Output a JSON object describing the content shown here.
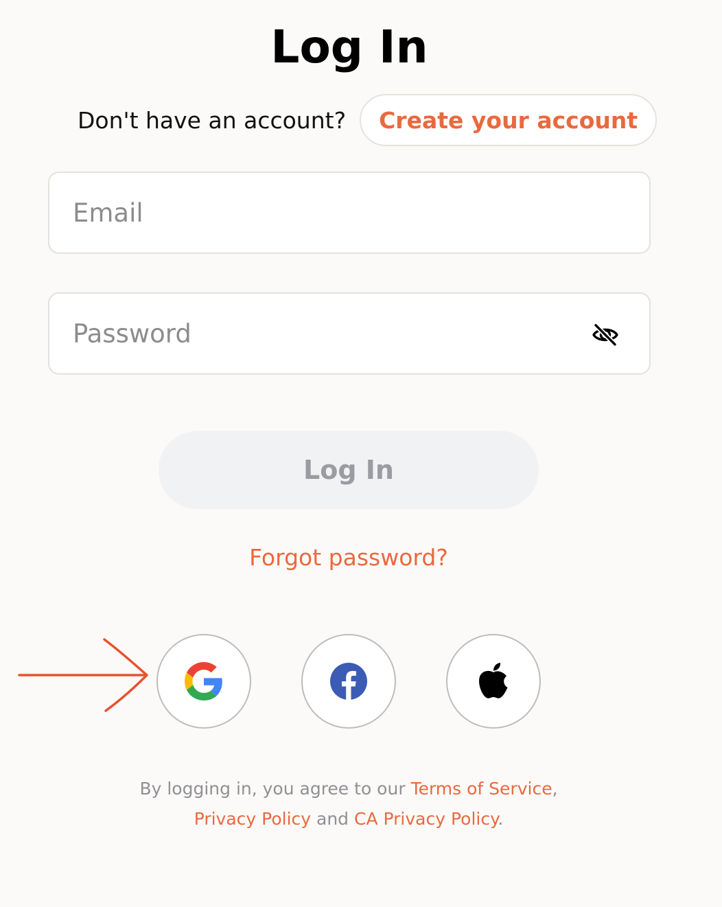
{
  "page": {
    "title": "Log In"
  },
  "signup": {
    "prompt": "Don't have an account?",
    "create_label": "Create your account"
  },
  "form": {
    "email_placeholder": "Email",
    "password_placeholder": "Password",
    "submit_label": "Log In",
    "forgot_label": "Forgot password?"
  },
  "social": {
    "providers": [
      {
        "name": "Google",
        "icon": "google-icon"
      },
      {
        "name": "Facebook",
        "icon": "facebook-icon"
      },
      {
        "name": "Apple",
        "icon": "apple-icon"
      }
    ]
  },
  "legal": {
    "prefix": "By logging in, you agree to our",
    "terms": "Terms of Service",
    "comma": ",",
    "privacy": "Privacy Policy",
    "and": "and",
    "ca_privacy": "CA Privacy Policy",
    "period": "."
  },
  "colors": {
    "accent": "#e9693f",
    "background": "#fcfaf8",
    "button_disabled_bg": "#f1f2f4",
    "button_disabled_text": "#9a9ca1",
    "annotation_arrow": "#e5532f"
  }
}
